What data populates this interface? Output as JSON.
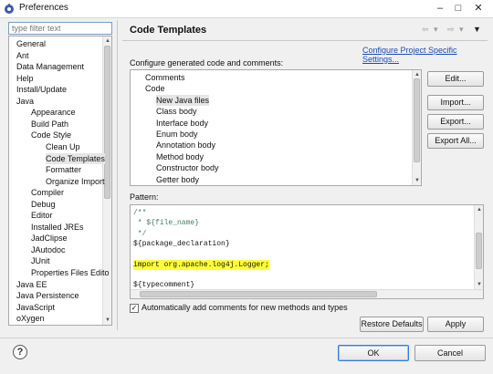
{
  "window": {
    "title": "Preferences",
    "controls": {
      "minimize": "–",
      "maximize": "□",
      "close": "✕"
    }
  },
  "filter": {
    "placeholder": "type filter text",
    "value": ""
  },
  "nav": {
    "items": [
      {
        "label": "General",
        "level": 0,
        "selected": false
      },
      {
        "label": "Ant",
        "level": 0,
        "selected": false
      },
      {
        "label": "Data Management",
        "level": 0,
        "selected": false
      },
      {
        "label": "Help",
        "level": 0,
        "selected": false
      },
      {
        "label": "Install/Update",
        "level": 0,
        "selected": false
      },
      {
        "label": "Java",
        "level": 0,
        "selected": false
      },
      {
        "label": "Appearance",
        "level": 1,
        "selected": false
      },
      {
        "label": "Build Path",
        "level": 1,
        "selected": false
      },
      {
        "label": "Code Style",
        "level": 1,
        "selected": false
      },
      {
        "label": "Clean Up",
        "level": 2,
        "selected": false
      },
      {
        "label": "Code Templates",
        "level": 2,
        "selected": true
      },
      {
        "label": "Formatter",
        "level": 2,
        "selected": false
      },
      {
        "label": "Organize Import",
        "level": 2,
        "selected": false
      },
      {
        "label": "Compiler",
        "level": 1,
        "selected": false
      },
      {
        "label": "Debug",
        "level": 1,
        "selected": false
      },
      {
        "label": "Editor",
        "level": 1,
        "selected": false
      },
      {
        "label": "Installed JREs",
        "level": 1,
        "selected": false
      },
      {
        "label": "JadClipse",
        "level": 1,
        "selected": false
      },
      {
        "label": "JAutodoc",
        "level": 1,
        "selected": false
      },
      {
        "label": "JUnit",
        "level": 1,
        "selected": false
      },
      {
        "label": "Properties Files Edito",
        "level": 1,
        "selected": false
      },
      {
        "label": "Java EE",
        "level": 0,
        "selected": false
      },
      {
        "label": "Java Persistence",
        "level": 0,
        "selected": false
      },
      {
        "label": "JavaScript",
        "level": 0,
        "selected": false
      },
      {
        "label": "oXygen",
        "level": 0,
        "selected": false
      }
    ]
  },
  "page": {
    "title": "Code Templates",
    "configure_link": "Configure Project Specific Settings...",
    "generate_label": "Configure generated code and comments:",
    "templates": [
      {
        "label": "Comments",
        "level": 0,
        "selected": false
      },
      {
        "label": "Code",
        "level": 0,
        "selected": false
      },
      {
        "label": "New Java files",
        "level": 1,
        "selected": true
      },
      {
        "label": "Class body",
        "level": 1,
        "selected": false
      },
      {
        "label": "Interface body",
        "level": 1,
        "selected": false
      },
      {
        "label": "Enum body",
        "level": 1,
        "selected": false
      },
      {
        "label": "Annotation body",
        "level": 1,
        "selected": false
      },
      {
        "label": "Method body",
        "level": 1,
        "selected": false
      },
      {
        "label": "Constructor body",
        "level": 1,
        "selected": false
      },
      {
        "label": "Getter body",
        "level": 1,
        "selected": false
      }
    ],
    "buttons": {
      "edit": "Edit...",
      "import": "Import...",
      "export": "Export...",
      "export_all": "Export All..."
    },
    "pattern_label": "Pattern:",
    "pattern_lines": [
      {
        "text": "/**",
        "style": "comment"
      },
      {
        "text": " * ${file_name}",
        "style": "comment"
      },
      {
        "text": " */",
        "style": "comment"
      },
      {
        "text": "${package_declaration}",
        "style": "normal"
      },
      {
        "text": "",
        "style": "normal"
      },
      {
        "text": "import org.apache.log4j.Logger;",
        "style": "highlight"
      },
      {
        "text": "",
        "style": "normal"
      },
      {
        "text": "${typecomment}",
        "style": "normal"
      }
    ],
    "auto_comment": {
      "checked": true,
      "label": "Automatically add comments for new methods and types"
    },
    "restore_defaults": "Restore Defaults",
    "apply": "Apply"
  },
  "footer": {
    "help": "?",
    "ok": "OK",
    "cancel": "Cancel"
  },
  "colors": {
    "link": "#1c4bb5",
    "highlight": "#ffff38",
    "comment": "#3f7f5f",
    "selection": "#e6e6e6"
  }
}
